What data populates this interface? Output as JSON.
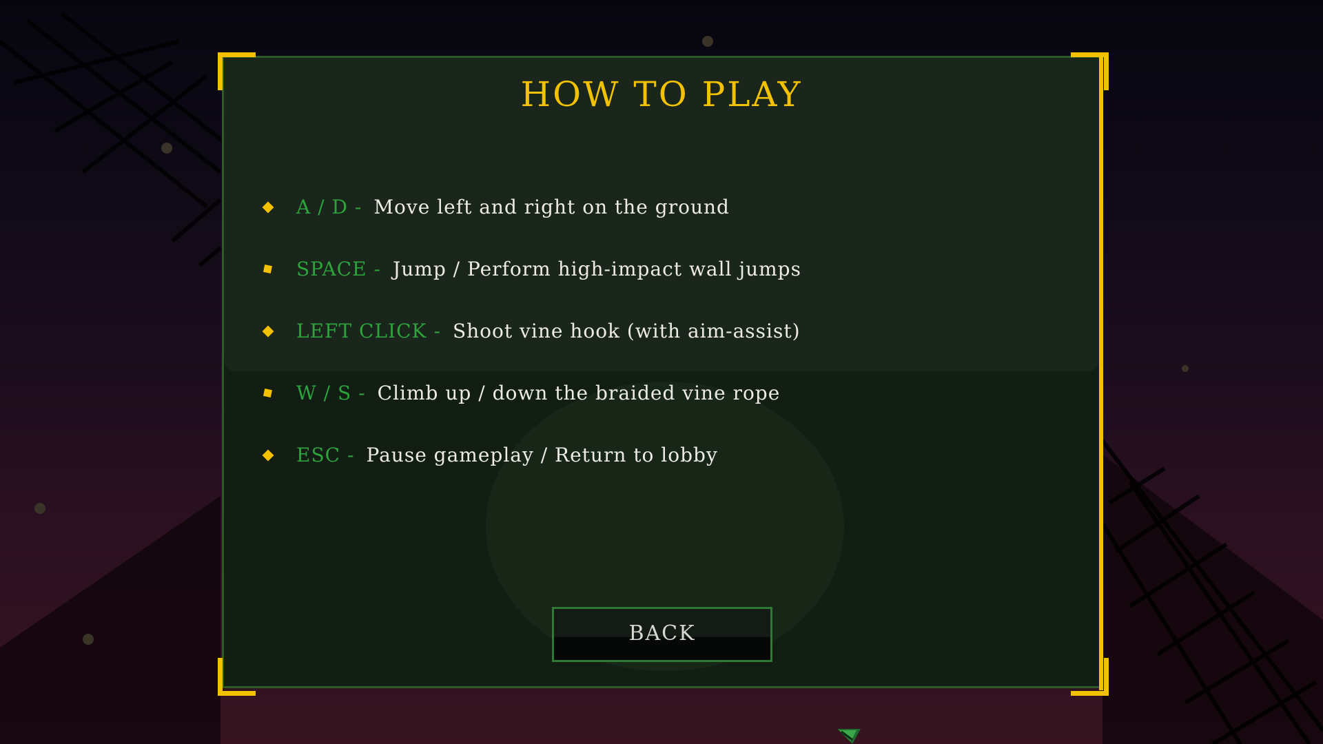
{
  "title": "HOW TO PLAY",
  "controls": [
    {
      "key": "A / D",
      "separator": "-",
      "description": "Move left and right on the ground",
      "bullet": "diamond"
    },
    {
      "key": "SPACE",
      "separator": "-",
      "description": "Jump / Perform high-impact wall jumps",
      "bullet": "square"
    },
    {
      "key": "LEFT CLICK",
      "separator": "-",
      "description": "Shoot vine hook (with aim-assist)",
      "bullet": "diamond"
    },
    {
      "key": "W / S",
      "separator": "-",
      "description": "Climb up / down the braided vine rope",
      "bullet": "square"
    },
    {
      "key": "ESC",
      "separator": "-",
      "description": "Pause gameplay / Return to lobby",
      "bullet": "diamond"
    }
  ],
  "back_button": {
    "label": "BACK"
  },
  "colors": {
    "accent_gold": "#f2c200",
    "key_green": "#2ea23c",
    "panel_border": "#2e5a28",
    "panel_bg": "#121e14",
    "text_light": "#ecece4"
  },
  "icons": {
    "bullet": "diamond-bullet-icon",
    "cursor": "arrow-cursor-icon"
  }
}
